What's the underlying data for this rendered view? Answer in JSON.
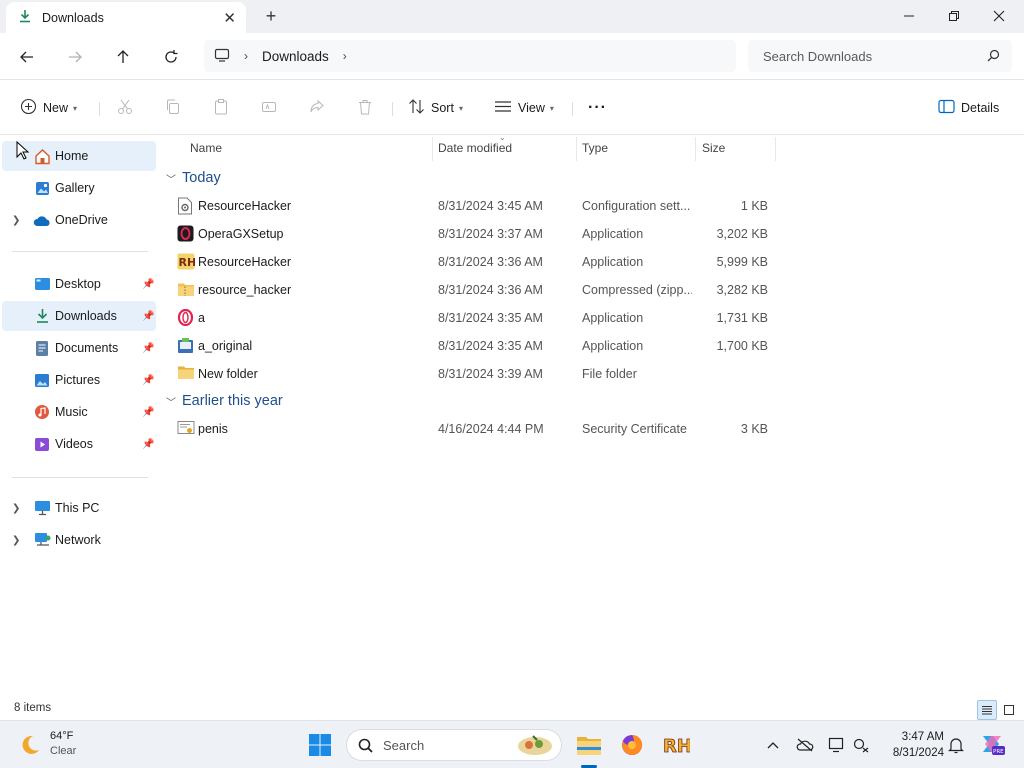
{
  "window": {
    "tab_title": "Downloads",
    "tab_close_glyph": "✕",
    "new_tab_glyph": "+"
  },
  "addressbar": {
    "breadcrumb": [
      "Downloads"
    ],
    "search_placeholder": "Search Downloads"
  },
  "commandbar": {
    "new_label": "New",
    "sort_label": "Sort",
    "view_label": "View",
    "more_glyph": "···",
    "details_label": "Details"
  },
  "sidebar": {
    "items": [
      {
        "label": "Home"
      },
      {
        "label": "Gallery"
      },
      {
        "label": "OneDrive"
      },
      {
        "label": "Desktop"
      },
      {
        "label": "Downloads"
      },
      {
        "label": "Documents"
      },
      {
        "label": "Pictures"
      },
      {
        "label": "Music"
      },
      {
        "label": "Videos"
      },
      {
        "label": "This PC"
      },
      {
        "label": "Network"
      }
    ]
  },
  "filelist": {
    "columns": [
      "Name",
      "Date modified",
      "Type",
      "Size"
    ],
    "groups": [
      {
        "label": "Today",
        "rows": [
          {
            "name": "ResourceHacker",
            "date": "8/31/2024 3:45 AM",
            "type": "Configuration sett...",
            "size": "1 KB",
            "icon": "config-file-icon"
          },
          {
            "name": "OperaGXSetup",
            "date": "8/31/2024 3:37 AM",
            "type": "Application",
            "size": "3,202 KB",
            "icon": "opera-gx-icon"
          },
          {
            "name": "ResourceHacker",
            "date": "8/31/2024 3:36 AM",
            "type": "Application",
            "size": "5,999 KB",
            "icon": "resource-hacker-icon"
          },
          {
            "name": "resource_hacker",
            "date": "8/31/2024 3:36 AM",
            "type": "Compressed (zipp...",
            "size": "3,282 KB",
            "icon": "zip-folder-icon"
          },
          {
            "name": "a",
            "date": "8/31/2024 3:35 AM",
            "type": "Application",
            "size": "1,731 KB",
            "icon": "opera-icon"
          },
          {
            "name": "a_original",
            "date": "8/31/2024 3:35 AM",
            "type": "Application",
            "size": "1,700 KB",
            "icon": "setup-app-icon"
          },
          {
            "name": "New folder",
            "date": "8/31/2024 3:39 AM",
            "type": "File folder",
            "size": "",
            "icon": "folder-icon"
          }
        ]
      },
      {
        "label": "Earlier this year",
        "rows": [
          {
            "name": "penis",
            "date": "4/16/2024 4:44 PM",
            "type": "Security Certificate",
            "size": "3 KB",
            "icon": "certificate-icon"
          }
        ]
      }
    ]
  },
  "status": {
    "item_count": "8 items"
  },
  "taskbar": {
    "weather_temp": "64°F",
    "weather_cond": "Clear",
    "search_label": "Search",
    "time": "3:47 AM",
    "date": "8/31/2024"
  },
  "colors": {
    "accent": "#0067c0",
    "selected_bg": "#e6f0fb",
    "group_header": "#1f4e8c",
    "folder": "#f2c24f"
  }
}
